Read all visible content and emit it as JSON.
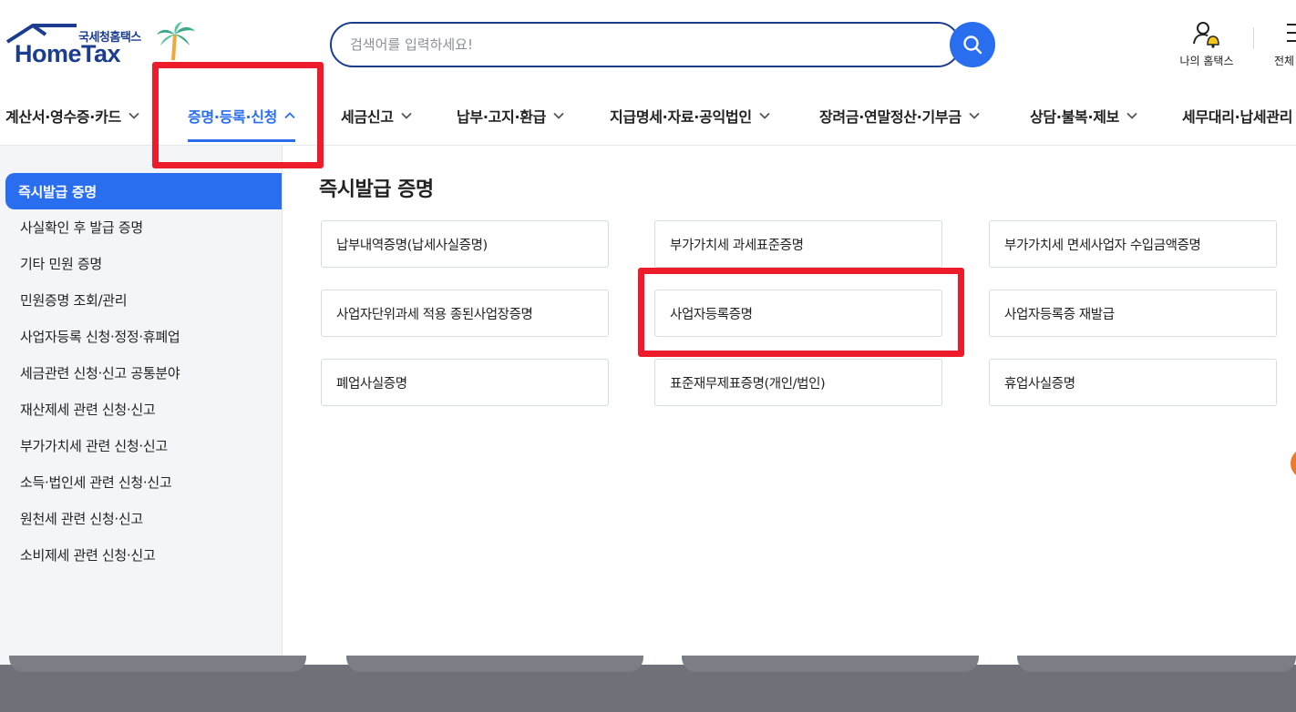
{
  "header": {
    "logo_kor": "국세청홈택스",
    "logo_eng": "HomeTax",
    "search_placeholder": "검색어를 입력하세요!",
    "my_hometax_label": "나의 홈택스",
    "all_menu_label": "전체"
  },
  "nav": {
    "items": [
      {
        "label": "계산서·영수증·카드",
        "active": false
      },
      {
        "label": "증명·등록·신청",
        "active": true
      },
      {
        "label": "세금신고",
        "active": false
      },
      {
        "label": "납부·고지·환급",
        "active": false
      },
      {
        "label": "지급명세·자료·공익법인",
        "active": false
      },
      {
        "label": "장려금·연말정산·기부금",
        "active": false
      },
      {
        "label": "상담·불복·제보",
        "active": false
      },
      {
        "label": "세무대리·납세관리",
        "active": false
      }
    ]
  },
  "sidebar": {
    "items": [
      {
        "label": "즉시발급 증명",
        "active": true
      },
      {
        "label": "사실확인 후 발급 증명"
      },
      {
        "label": "기타 민원 증명"
      },
      {
        "label": "민원증명 조회/관리"
      },
      {
        "label": "사업자등록 신청·정정·휴폐업"
      },
      {
        "label": "세금관련 신청·신고 공통분야"
      },
      {
        "label": "재산제세 관련 신청·신고"
      },
      {
        "label": "부가가치세 관련 신청·신고"
      },
      {
        "label": "소득·법인세 관련 신청·신고"
      },
      {
        "label": "원천세 관련 신청·신고"
      },
      {
        "label": "소비제세 관련 신청·신고"
      }
    ]
  },
  "main": {
    "title": "즉시발급 증명",
    "cards": [
      {
        "label": "납부내역증명(납세사실증명)"
      },
      {
        "label": "부가가치세 과세표준증명"
      },
      {
        "label": "부가가치세 면세사업자 수입금액증명"
      },
      {
        "label": "사업자단위과세 적용 종된사업장증명"
      },
      {
        "label": "사업자등록증명"
      },
      {
        "label": "사업자등록증 재발급"
      },
      {
        "label": "폐업사실증명"
      },
      {
        "label": "표준재무제표증명(개인/법인)"
      },
      {
        "label": "휴업사실증명"
      }
    ]
  },
  "colors": {
    "brand_navy": "#1c3d8f",
    "accent_blue": "#2a6ef0",
    "highlight_red": "#ec1c2b"
  }
}
